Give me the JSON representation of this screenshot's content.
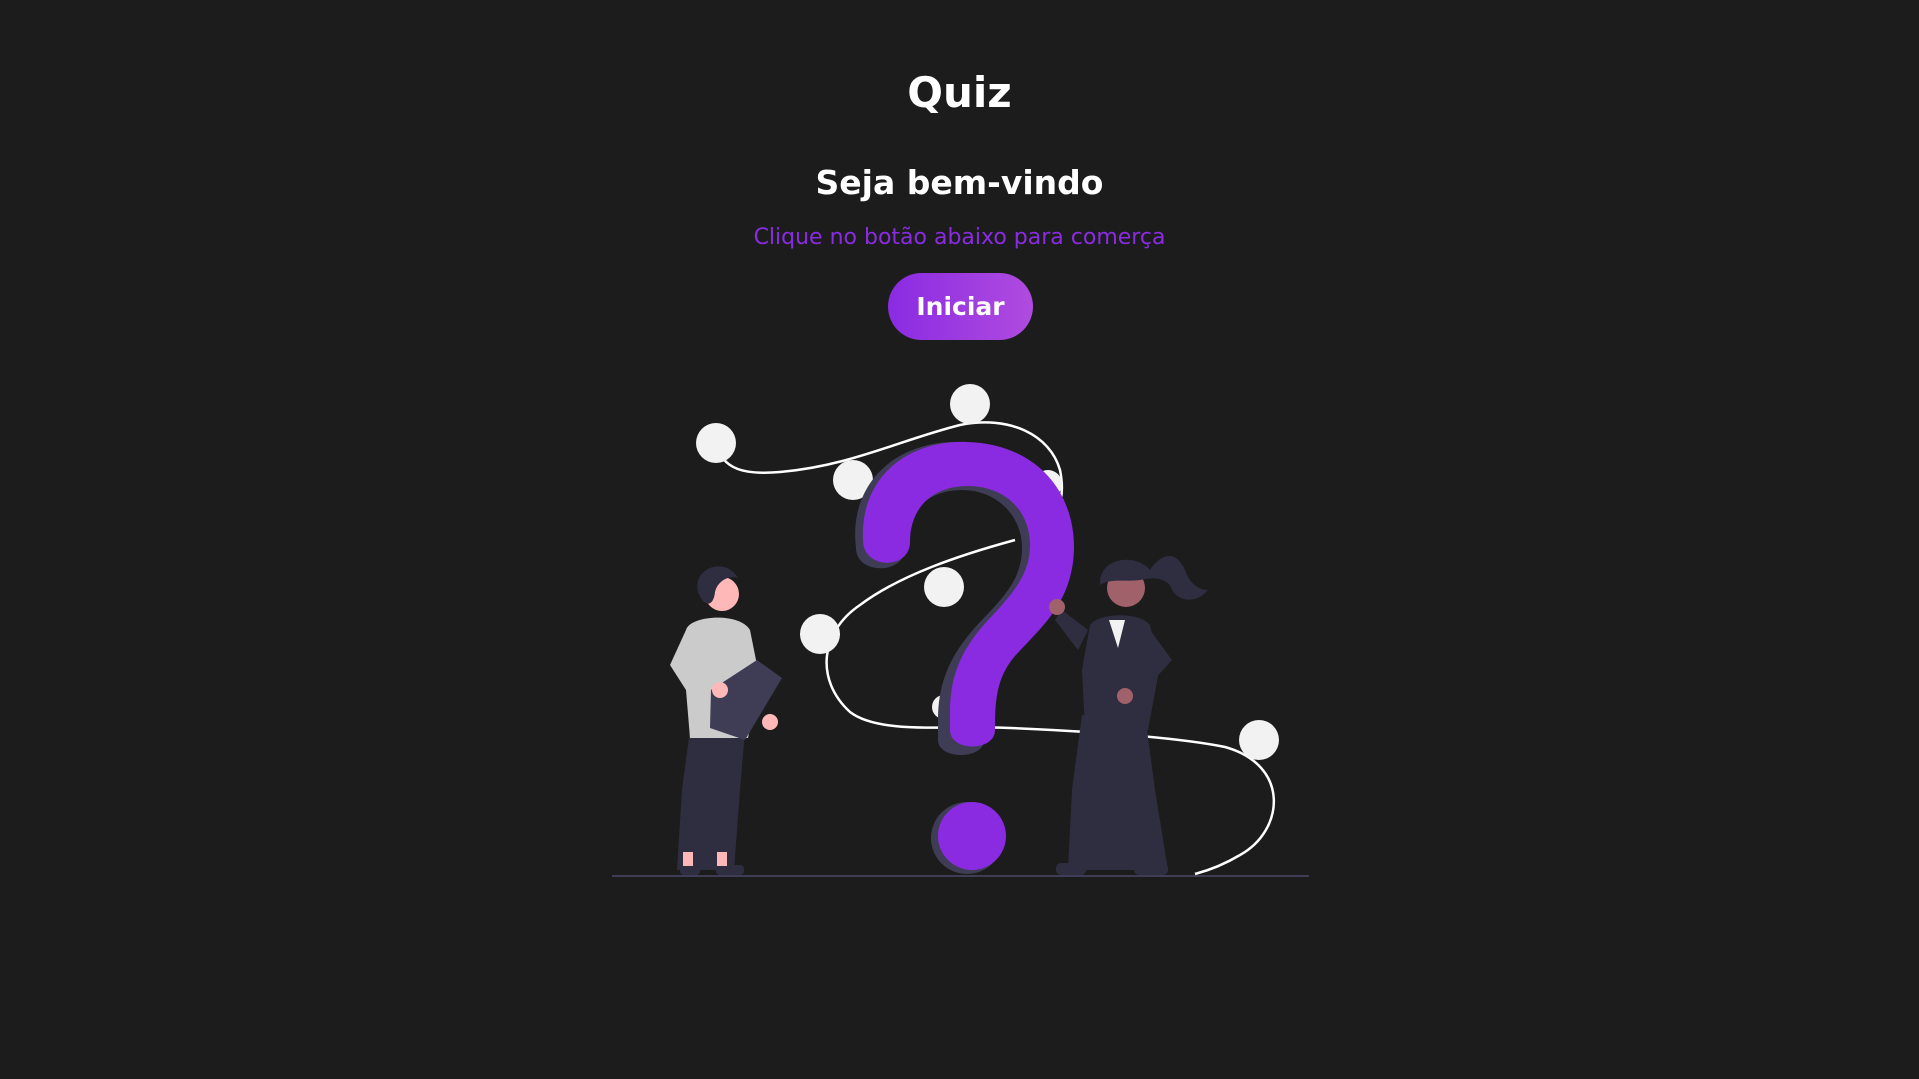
{
  "header": {
    "title": "Quiz"
  },
  "welcome": {
    "heading": "Seja bem-vindo",
    "instruction": "Clique no botão abaixo para comerça"
  },
  "actions": {
    "start_label": "Iniciar"
  },
  "colors": {
    "background": "#1c1c1d",
    "accent": "#8a2be2",
    "accent_gradient_end": "#b04bdf",
    "text": "#ffffff",
    "figure_dark": "#2f2e41",
    "dots": "#f2f2f2"
  },
  "illustration": {
    "icon": "question-mark-people-illustration"
  }
}
